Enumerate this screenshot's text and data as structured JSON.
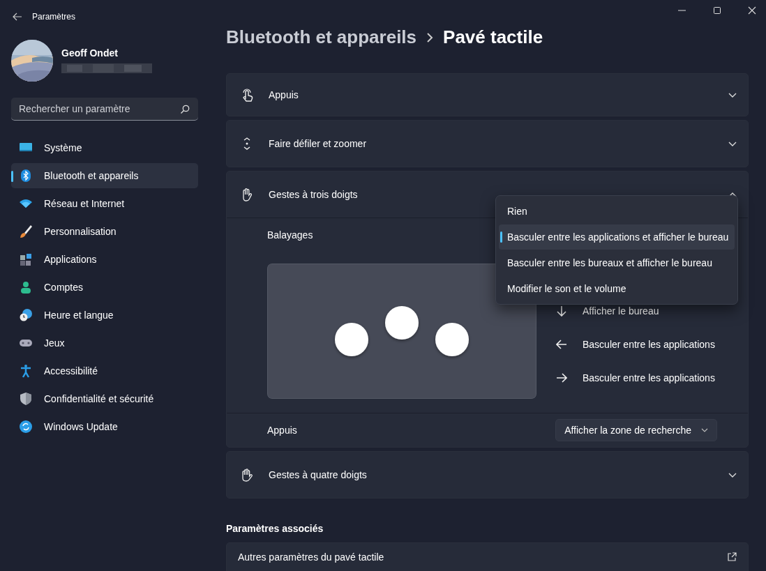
{
  "window": {
    "title": "Paramètres"
  },
  "profile": {
    "name": "Geoff Ondet"
  },
  "search": {
    "placeholder": "Rechercher un paramètre"
  },
  "sidebar": {
    "items": [
      {
        "label": "Système",
        "selected": false
      },
      {
        "label": "Bluetooth et appareils",
        "selected": true
      },
      {
        "label": "Réseau et Internet",
        "selected": false
      },
      {
        "label": "Personnalisation",
        "selected": false
      },
      {
        "label": "Applications",
        "selected": false
      },
      {
        "label": "Comptes",
        "selected": false
      },
      {
        "label": "Heure et langue",
        "selected": false
      },
      {
        "label": "Jeux",
        "selected": false
      },
      {
        "label": "Accessibilité",
        "selected": false
      },
      {
        "label": "Confidentialité et sécurité",
        "selected": false
      },
      {
        "label": "Windows Update",
        "selected": false
      }
    ]
  },
  "breadcrumb": {
    "parent": "Bluetooth et appareils",
    "current": "Pavé tactile"
  },
  "sections": [
    {
      "title": "Appuis",
      "expanded": false
    },
    {
      "title": "Faire défiler et zoomer",
      "expanded": false
    },
    {
      "title": "Gestes à trois doigts",
      "expanded": true,
      "swipes": {
        "label": "Balayages",
        "actions": [
          {
            "label": "Afficher le bureau"
          },
          {
            "label": "Basculer entre les applications"
          },
          {
            "label": "Basculer entre les applications"
          }
        ],
        "menu": {
          "options": [
            {
              "label": "Rien",
              "selected": false
            },
            {
              "label": "Basculer entre les applications et afficher le bureau",
              "selected": true
            },
            {
              "label": "Basculer entre les bureaux et afficher le bureau",
              "selected": false
            },
            {
              "label": "Modifier le son et le volume",
              "selected": false
            }
          ]
        }
      },
      "taps": {
        "label": "Appuis",
        "value": "Afficher la zone de recherche"
      }
    },
    {
      "title": "Gestes à quatre doigts",
      "expanded": false
    }
  ],
  "related": {
    "heading": "Paramètres associés",
    "items": [
      {
        "title": "Autres paramètres du pavé tactile"
      }
    ]
  }
}
